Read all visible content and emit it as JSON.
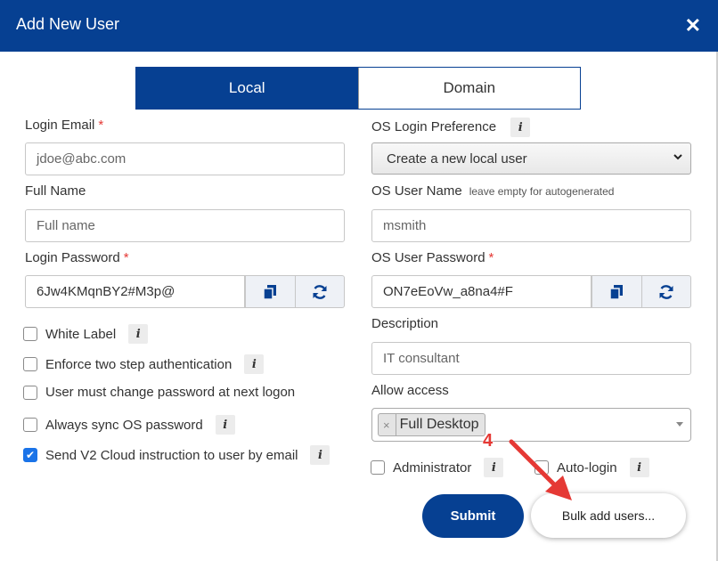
{
  "dialog": {
    "title": "Add New User"
  },
  "tabs": [
    {
      "label": "Local",
      "active": true
    },
    {
      "label": "Domain",
      "active": false
    }
  ],
  "left": {
    "login_email": {
      "label": "Login Email",
      "required": "*",
      "placeholder": "jdoe@abc.com"
    },
    "full_name": {
      "label": "Full Name",
      "placeholder": "Full name"
    },
    "login_password": {
      "label": "Login Password",
      "required": "*",
      "value": "6Jw4KMqnBY2#M3p@"
    },
    "checkboxes": [
      {
        "label": "White Label",
        "checked": false,
        "info": "i"
      },
      {
        "label": "Enforce two step authentication",
        "checked": false,
        "info": "i"
      },
      {
        "label": "User must change password at next logon",
        "checked": false
      },
      {
        "label": "Always sync OS password",
        "checked": false,
        "info": "i"
      },
      {
        "label": "Send V2 Cloud instruction to user by email",
        "checked": true,
        "info": "i"
      }
    ]
  },
  "right": {
    "os_login_pref": {
      "label": "OS Login Preference",
      "info": "i",
      "value": "Create a new local user"
    },
    "os_user_name": {
      "label": "OS User Name",
      "hint": "leave empty for autogenerated",
      "placeholder": "msmith"
    },
    "os_user_password": {
      "label": "OS User Password",
      "required": "*",
      "value": "ON7eEoVw_a8na4#F"
    },
    "description": {
      "label": "Description",
      "placeholder": "IT consultant"
    },
    "allow_access": {
      "label": "Allow access",
      "chip": "Full Desktop",
      "chip_remove": "×"
    },
    "administrator": {
      "label": "Administrator",
      "checked": false,
      "info": "i"
    },
    "auto_login": {
      "label": "Auto-login",
      "checked": false,
      "info": "i"
    }
  },
  "buttons": {
    "submit": "Submit",
    "bulk": "Bulk add users..."
  },
  "annotation": {
    "number": "4",
    "color": "#e53935"
  },
  "colors": {
    "brand": "#064092",
    "required": "#e53935",
    "checkbox_checked": "#1a73e8"
  },
  "icons": {
    "close": "close-icon",
    "copy": "copy-icon",
    "refresh": "refresh-icon"
  }
}
